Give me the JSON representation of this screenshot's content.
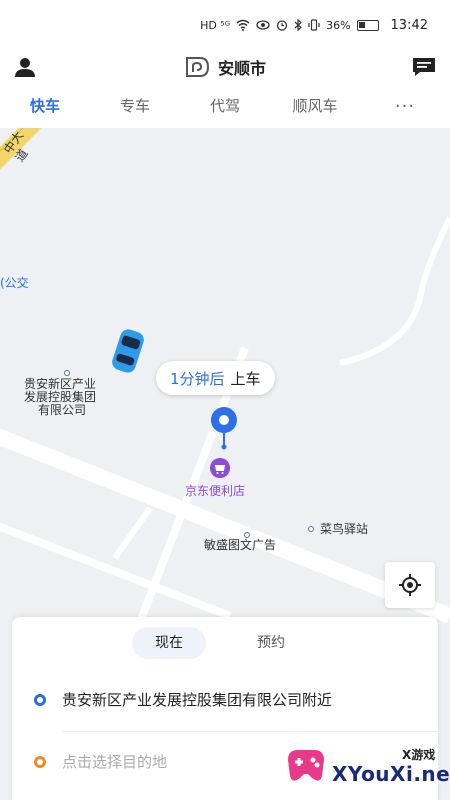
{
  "status_bar": {
    "network_badges": "HD ⁵ᴳ",
    "battery": "36%",
    "time": "13:42"
  },
  "header": {
    "title": "安顺市"
  },
  "tabs": [
    {
      "label": "快车"
    },
    {
      "label": "专车"
    },
    {
      "label": "代驾"
    },
    {
      "label": "顺风车"
    }
  ],
  "tabs_more": "···",
  "map": {
    "road_label": "中大道",
    "bus_label": "(公交",
    "poi_company": [
      "贵安新区产业",
      "发展控股集团",
      "有限公司"
    ],
    "poi_shop": "京东便利店",
    "poi_station": "菜鸟驿站",
    "poi_print": "敏盛图文广告",
    "pickup_time": "1分钟后",
    "pickup_action": "上车"
  },
  "card": {
    "segments": [
      {
        "label": "现在"
      },
      {
        "label": "预约"
      }
    ],
    "from_text": "贵安新区产业发展控股集团有限公司附近",
    "to_placeholder": "点击选择目的地"
  },
  "watermark": {
    "small": "X游戏",
    "text": "XYouXi.net"
  },
  "colors": {
    "accent": "#2d6fe8",
    "destination": "#f08a24",
    "shop": "#8a4dd8"
  }
}
